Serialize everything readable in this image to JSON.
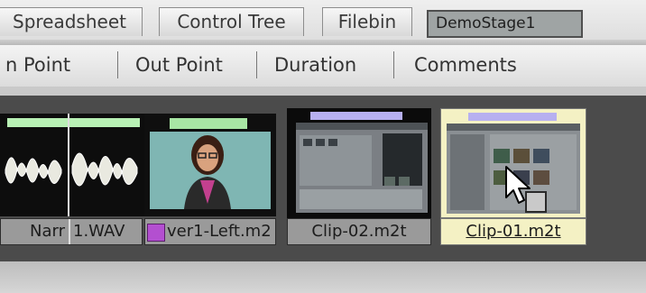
{
  "tabs": [
    {
      "label": "Spreadsheet"
    },
    {
      "label": "Control Tree"
    },
    {
      "label": "Filebin"
    }
  ],
  "stage_field": {
    "value": "DemoStage1"
  },
  "columns": [
    {
      "label": "n Point"
    },
    {
      "label": "Out Point"
    },
    {
      "label": "Duration"
    },
    {
      "label": "Comments"
    }
  ],
  "clips": [
    {
      "name_left": "Narr",
      "name_right": "1.WAV",
      "type": "audio-waveform",
      "bar_color": "#b8f0b4"
    },
    {
      "name": "ver1-Left.m2",
      "type": "video-presenter",
      "bar_color": "#a8e6a4",
      "has_badge": true
    },
    {
      "name": "Clip-02.m2t",
      "type": "video-screen",
      "bar_color": "#b7b0f0"
    },
    {
      "name": "Clip-01.m2t",
      "type": "video-screen",
      "bar_color": "#b7b0f0",
      "selected": true
    }
  ],
  "colors": {
    "bin_background": "#4b4b4b",
    "selected_label": "#f4f1c4",
    "label": "#9a9a9a"
  }
}
